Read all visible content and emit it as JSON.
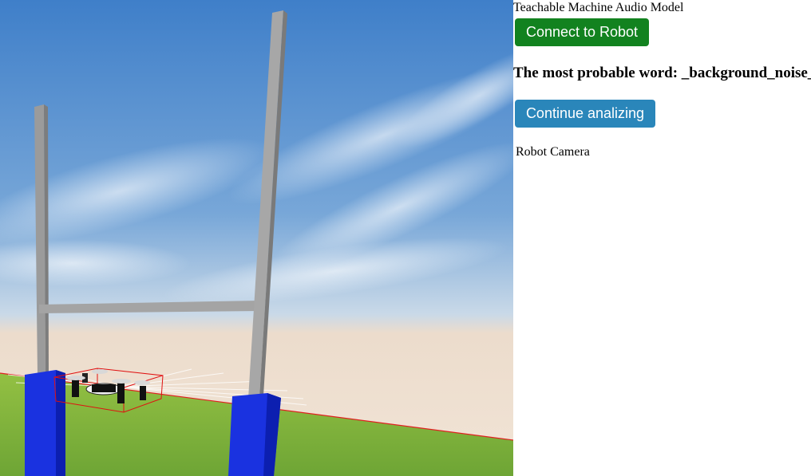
{
  "app": {
    "title": "Teachable Machine Audio Model"
  },
  "buttons": {
    "connect_label": "Connect to Robot",
    "continue_label": "Continue analizing"
  },
  "prediction": {
    "prefix": "The most probable word: ",
    "word": "_background_noise_"
  },
  "camera": {
    "label": "Robot Camera"
  },
  "colors": {
    "connect_button": "#12821f",
    "continue_button": "#2a86ba",
    "goal_posts_base": "#1230d8",
    "goal_posts_upright": "#9a9a9a",
    "grass": "#7bb03a",
    "drone_bounding_box": "#e01010"
  }
}
